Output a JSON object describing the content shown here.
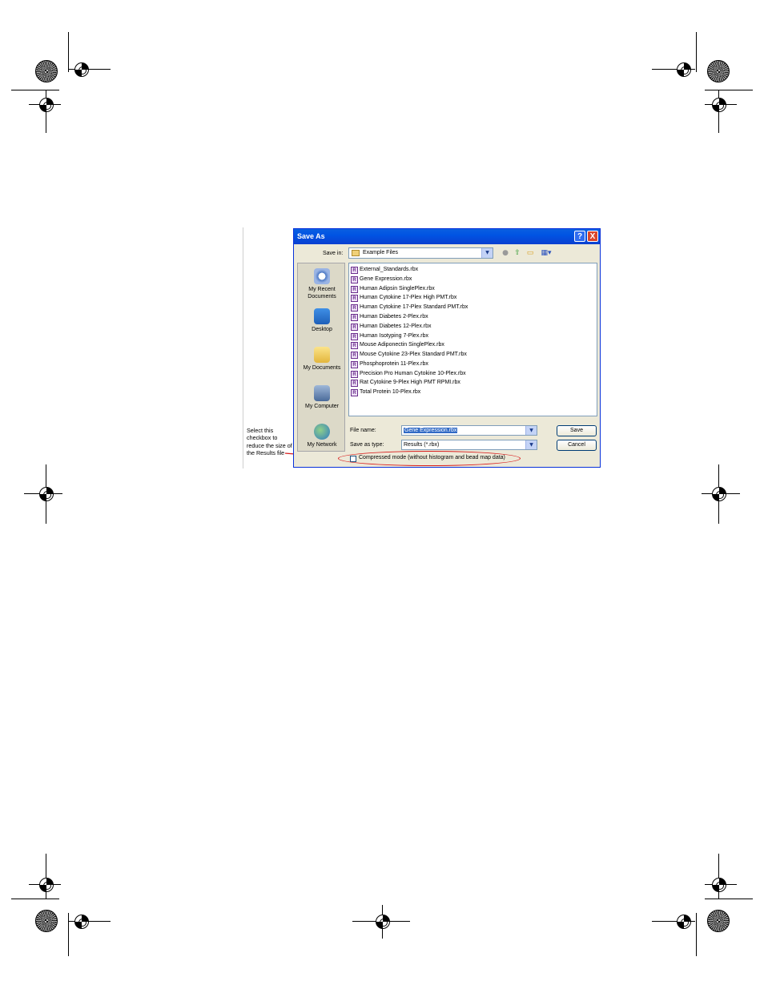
{
  "annotation": {
    "text": "Select this checkbox to reduce the size of the Results file"
  },
  "dialog": {
    "title": "Save As",
    "help_button": "?",
    "close_button": "X",
    "save_in_label": "Save in:",
    "save_in_value": "Example Files",
    "places": [
      {
        "label": "My Recent Documents",
        "icon": "recent-documents-icon"
      },
      {
        "label": "Desktop",
        "icon": "desktop-icon"
      },
      {
        "label": "My Documents",
        "icon": "my-documents-icon"
      },
      {
        "label": "My Computer",
        "icon": "my-computer-icon"
      },
      {
        "label": "My Network",
        "icon": "my-network-icon"
      }
    ],
    "files": [
      "External_Standards.rbx",
      "Gene Expression.rbx",
      "Human Adipsin SinglePlex.rbx",
      "Human Cytokine 17-Plex High PMT.rbx",
      "Human Cytokine 17-Plex Standard PMT.rbx",
      "Human Diabetes 2-Plex.rbx",
      "Human Diabetes 12-Plex.rbx",
      "Human Isotyping 7-Plex.rbx",
      "Mouse Adiponectin SinglePlex.rbx",
      "Mouse Cytokine 23-Plex Standard PMT.rbx",
      "Phosphoprotein 11-Plex.rbx",
      "Precision Pro Human Cytokine 10-Plex.rbx",
      "Rat Cytokine 9-Plex High PMT RPMI.rbx",
      "Total Protein 10-Plex.rbx"
    ],
    "file_name_label": "File name:",
    "file_name_value": "Gene Expression.rbx",
    "save_as_type_label": "Save as type:",
    "save_as_type_value": "Results (*.rbx)",
    "save_button": "Save",
    "cancel_button": "Cancel",
    "compressed_label": "Compressed mode (without histogram and bead map data)",
    "compressed_checked": false
  },
  "colors": {
    "titlebar": "#0054e3",
    "dialog_bg": "#ece9d8",
    "highlight": "#d81d1d",
    "file_icon": "#6a2c8c"
  }
}
